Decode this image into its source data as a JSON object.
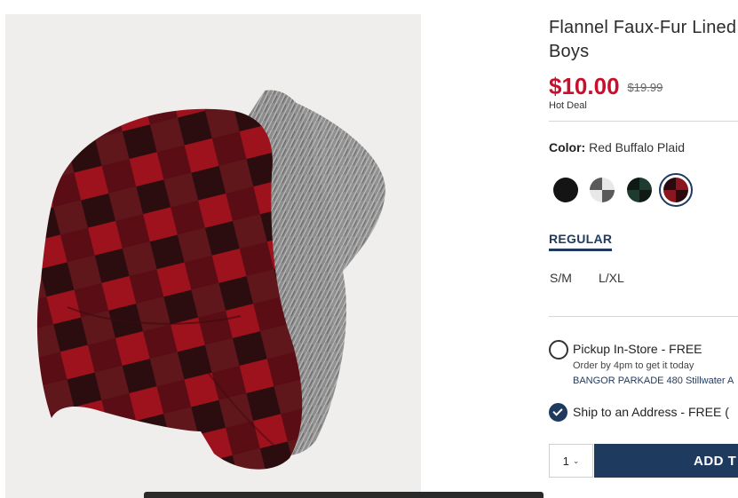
{
  "product": {
    "title_line1": "Flannel Faux-Fur Lined",
    "title_line2": "Boys",
    "price": "$10.00",
    "original_price": "$19.99",
    "deal_label": "Hot Deal",
    "image_alt": "red-buffalo-plaid-trapper-hat"
  },
  "color": {
    "label": "Color:",
    "value": "Red Buffalo Plaid",
    "swatches": [
      {
        "name": "Black",
        "color": "#141414"
      },
      {
        "name": "White Plaid",
        "color": "#cfcfcf"
      },
      {
        "name": "Green Plaid",
        "color": "#1d3b2e"
      },
      {
        "name": "Red Buffalo Plaid",
        "color": "#6e1620",
        "selected": true
      }
    ]
  },
  "fit": {
    "tab_label": "REGULAR"
  },
  "sizes": [
    "S/M",
    "L/XL"
  ],
  "fulfillment": {
    "pickup_label": "Pickup In-Store - FREE",
    "pickup_note": "Order by 4pm to get it today",
    "pickup_store": "BANGOR PARKADE 480 Stillwater A",
    "ship_label": "Ship to an Address - FREE ("
  },
  "cart": {
    "quantity": "1",
    "add_button": "ADD T"
  },
  "colors": {
    "brand_navy": "#1f3a5f",
    "sale_red": "#c8102e"
  }
}
